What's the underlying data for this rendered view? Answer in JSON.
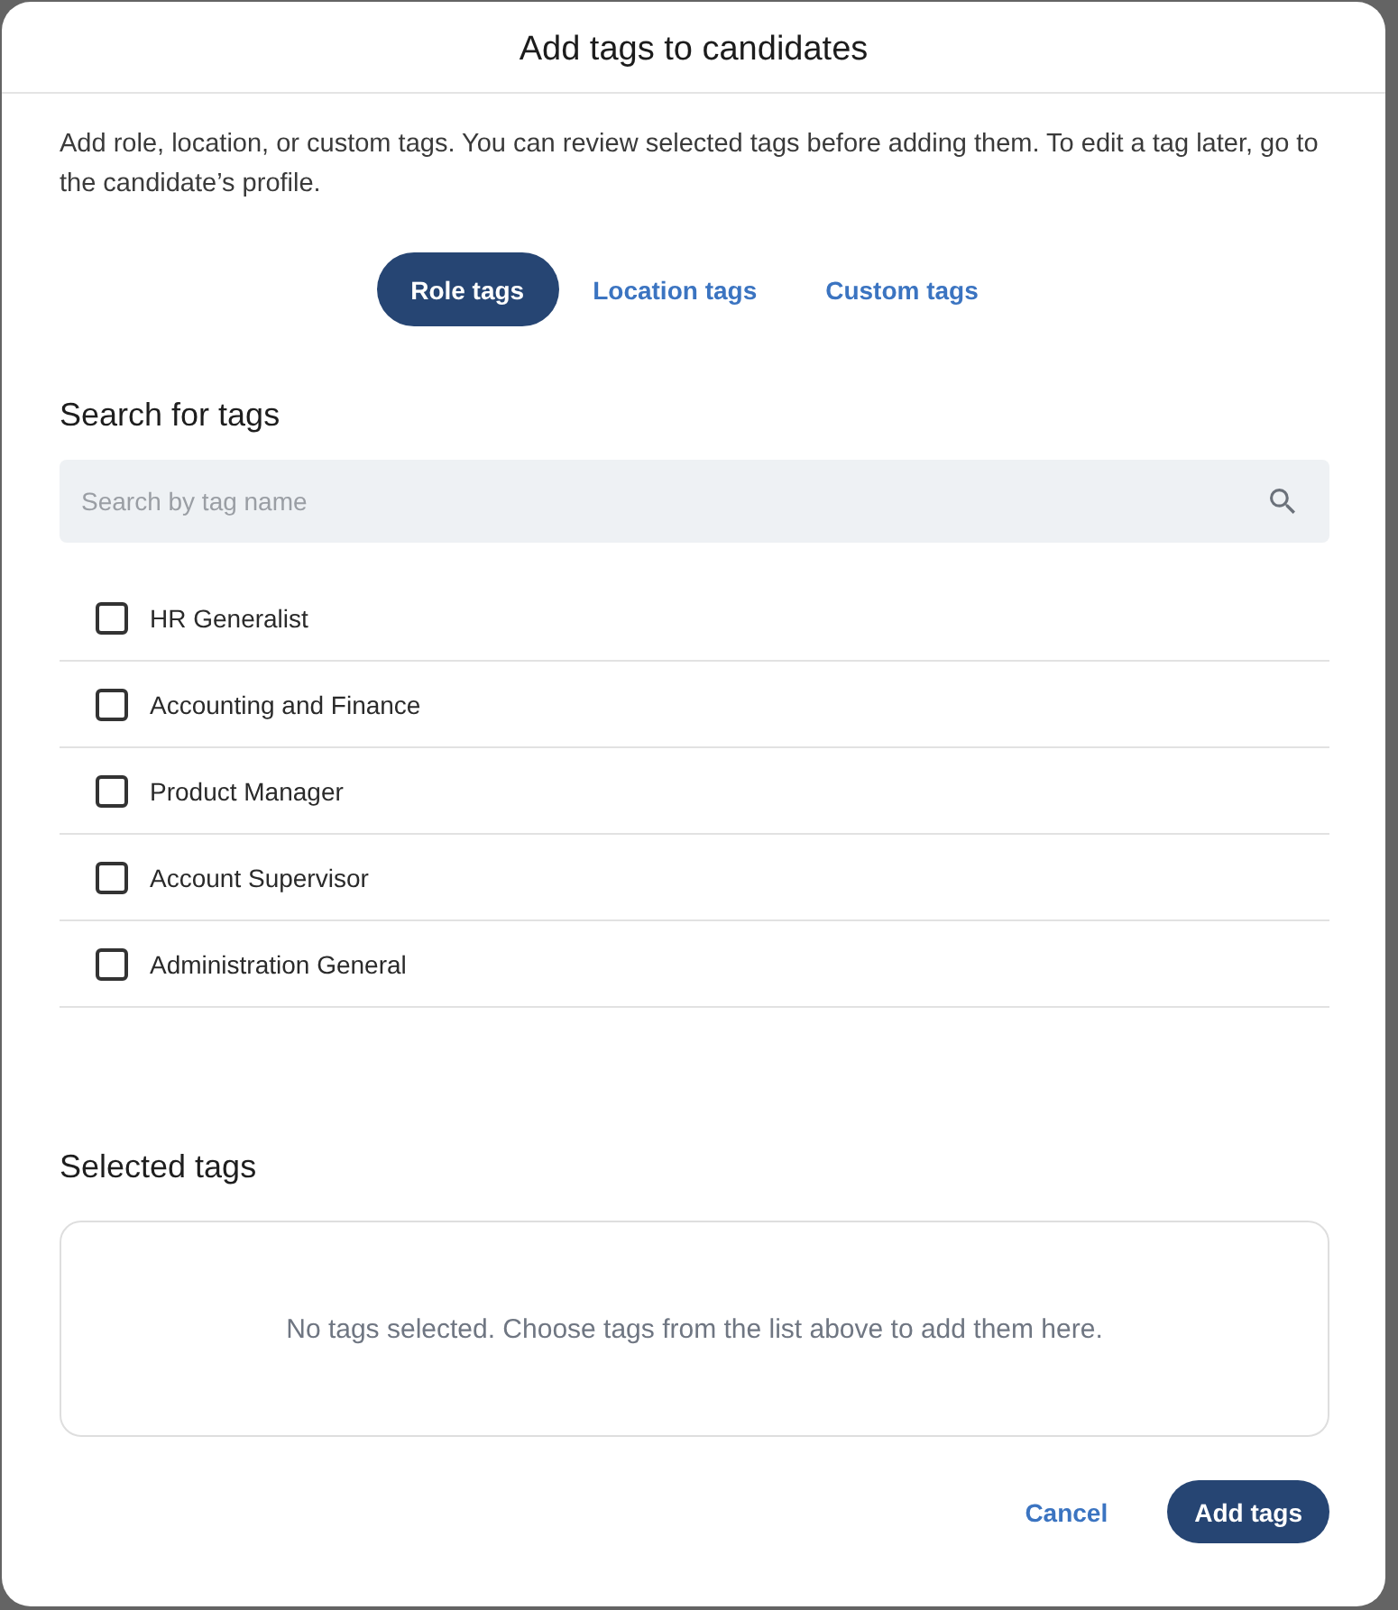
{
  "dialog": {
    "title": "Add tags to candidates",
    "description": "Add role, location, or custom tags. You can review selected tags before adding them. To edit a tag later, go to the candidate’s profile."
  },
  "tabs": [
    {
      "label": "Role tags",
      "selected": true
    },
    {
      "label": "Location tags",
      "selected": false
    },
    {
      "label": "Custom tags",
      "selected": false
    }
  ],
  "search": {
    "heading": "Search for tags",
    "placeholder": "Search by tag name"
  },
  "tag_list": [
    {
      "label": "HR Generalist",
      "checked": false
    },
    {
      "label": "Accounting and Finance",
      "checked": false
    },
    {
      "label": "Product Manager",
      "checked": false
    },
    {
      "label": "Account Supervisor",
      "checked": false
    },
    {
      "label": "Administration General",
      "checked": false
    }
  ],
  "selected_tags": {
    "heading": "Selected tags",
    "empty_message": "No tags selected. Choose tags from the list above to add them here."
  },
  "buttons": [
    {
      "label": "Cancel",
      "kind": "link"
    },
    {
      "label": "Add tags",
      "kind": "primary"
    }
  ]
}
